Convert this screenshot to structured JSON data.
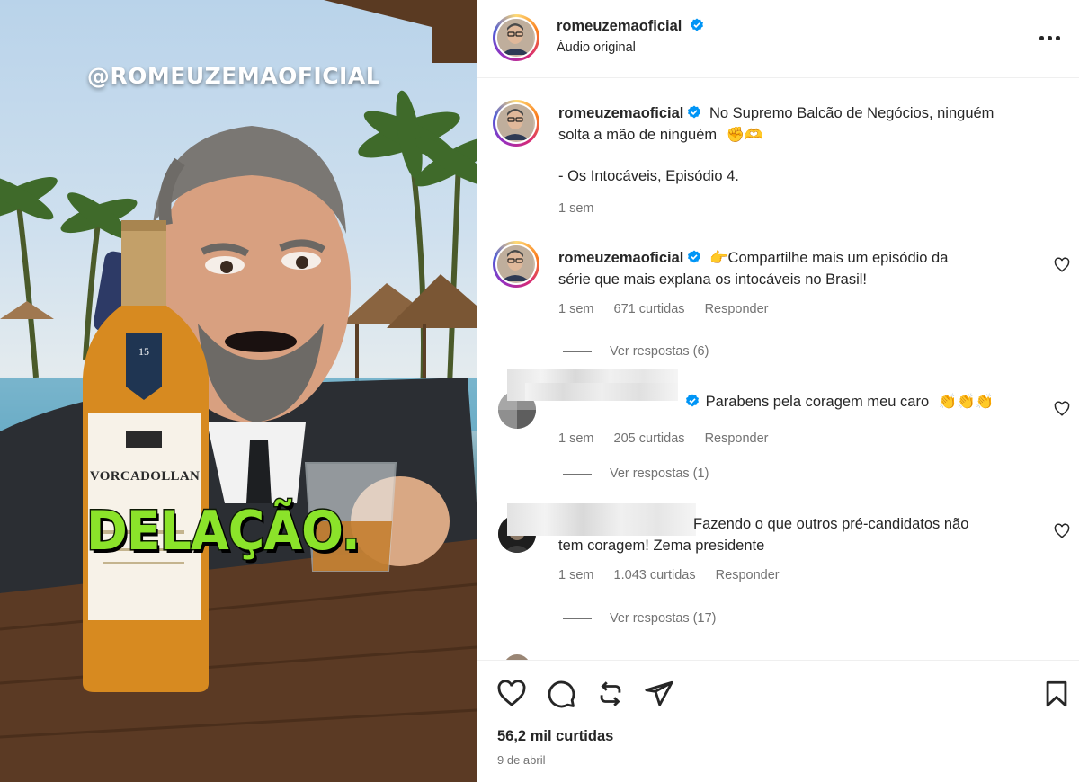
{
  "media": {
    "watermark": "@ROMEUZEMAOFICIAL",
    "caption_word": "DELAÇÃO.",
    "bottle_brand": "VORCADOLLAN",
    "bottle_age": "15",
    "caption_color": "#8be32a"
  },
  "header": {
    "username": "romeuzemaoficial",
    "audio": "Áudio original",
    "more_icon": "more-horizontal-icon"
  },
  "post_caption": {
    "username": "romeuzemaoficial",
    "text_line1": "No Supremo Balcão de Negócios, ninguém",
    "text_line2": "solta a mão de ninguém",
    "emojis": "✊🫶",
    "text_line3": "- Os Intocáveis, Episódio 4.",
    "time": "1 sem"
  },
  "comments": [
    {
      "username": "romeuzemaoficial",
      "text_line1": "👉Compartilhe mais um episódio da",
      "text_line2": "série que mais explana os intocáveis no Brasil!",
      "time": "1 sem",
      "likes": "671 curtidas",
      "reply": "Responder",
      "see_replies": "Ver respostas (6)"
    },
    {
      "username": "",
      "text_line1": "Parabens pela coragem meu caro",
      "emojis": "👏👏👏",
      "time": "1 sem",
      "likes": "205 curtidas",
      "reply": "Responder",
      "see_replies": "Ver respostas (1)"
    },
    {
      "username": "",
      "text_line1": "Fazendo o que outros pré-candidatos não",
      "text_line2": "tem coragem! Zema presidente",
      "time": "1 sem",
      "likes": "1.043 curtidas",
      "reply": "Responder",
      "see_replies": "Ver respostas (17)"
    }
  ],
  "footer": {
    "likes": "56,2 mil curtidas",
    "date": "9 de abril"
  },
  "colors": {
    "verified": "#0095f6",
    "text": "#262626",
    "secondary": "#737373"
  }
}
